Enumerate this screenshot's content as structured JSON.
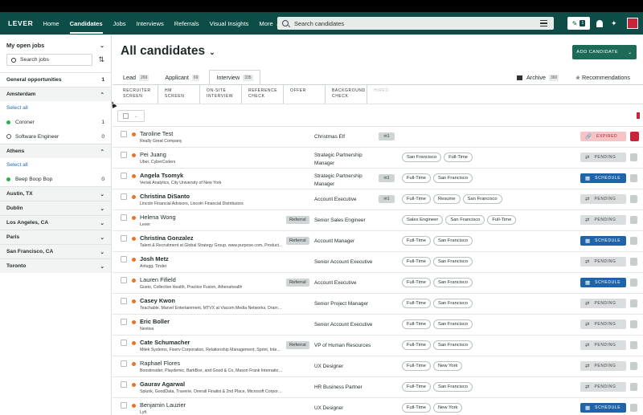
{
  "nav": {
    "logo": "LEVER",
    "items": [
      "Home",
      "Candidates",
      "Jobs",
      "Interviews",
      "Referrals",
      "Visual Insights",
      "More"
    ],
    "search_placeholder": "Search candidates",
    "note_count": "1"
  },
  "sidebar": {
    "title": "My open jobs",
    "search_placeholder": "Search jobs",
    "general": {
      "label": "General opportunities",
      "count": "1"
    },
    "amsterdam": {
      "label": "Amsterdam",
      "select_all": "Select all",
      "jobs": [
        {
          "name": "Coroner",
          "count": "1"
        },
        {
          "name": "Software Engineer",
          "count": "0"
        }
      ]
    },
    "athens": {
      "label": "Athens",
      "select_all": "Select all",
      "jobs": [
        {
          "name": "Beep Boop Bop",
          "count": "0"
        }
      ]
    },
    "collapsed": [
      "Austin, TX",
      "Dublin",
      "Los Angeles, CA",
      "Paris",
      "San Francisco, CA",
      "Toronto"
    ]
  },
  "main": {
    "title": "All candidates",
    "add_button": "ADD CANDIDATE",
    "tabs": [
      {
        "label": "Lead",
        "count": "269"
      },
      {
        "label": "Applicant",
        "count": "69"
      },
      {
        "label": "Interview",
        "count": "335"
      }
    ],
    "archive": {
      "label": "Archive",
      "count": "360"
    },
    "recommendations": "Recommendations",
    "stages": [
      "RECRUITER SCREEN",
      "HM SCREEN",
      "ON-SITE INTERVIEW",
      "REFERENCE CHECK",
      "OFFER",
      "BACKGROUND CHECK",
      "HIRED"
    ]
  },
  "rows": [
    {
      "name": "Taroline Test",
      "sub": "Really Great Company",
      "position": "Christmas Elf",
      "msg": "1",
      "tags": [],
      "status": "EXPIRED",
      "bold": false
    },
    {
      "name": "Pei Juang",
      "sub": "Uber, CyberCoders",
      "position": "Strategic Partnership Manager",
      "tags": [
        "San Francisco",
        "Full-Time"
      ],
      "status": "PENDING",
      "bold": false
    },
    {
      "name": "Angela Tsomyk",
      "sub": "Verisk Analytics, City University of New York",
      "position": "Strategic Partnership Manager",
      "msg": "1",
      "tags": [
        "Full-Time",
        "San Francisco"
      ],
      "status": "SCHEDULE",
      "bold": true
    },
    {
      "name": "Christina DiSanto",
      "sub": "Lincoln Financial Advisors, Lincoln Financial Distributors",
      "position": "Account Executive",
      "msg": "1",
      "tags": [
        "Full-Time",
        "Resume",
        "San Francisco"
      ],
      "status": "PENDING",
      "bold": true
    },
    {
      "name": "Helena Wong",
      "sub": "Lever",
      "referral": "Referral",
      "position": "Senior Sales Engineer",
      "tags": [
        "Sales Engineer",
        "San Francisco",
        "Full-Time"
      ],
      "status": "PENDING",
      "bold": false
    },
    {
      "name": "Christina Gonzalez",
      "sub": "Talent & Recruitment at Global Strategy Group, www.purpose.com, Product...",
      "referral": "Referral",
      "position": "Account Manager",
      "tags": [
        "Full-Time",
        "San Francisco"
      ],
      "status": "SCHEDULE",
      "bold": true
    },
    {
      "name": "Josh Metz",
      "sub": "Airlugg, Tinder",
      "position": "Senior Account Executive",
      "tags": [
        "Full-Time",
        "San Francisco"
      ],
      "status": "PENDING",
      "bold": true
    },
    {
      "name": "Lauren Fifield",
      "sub": "Gusto, Collective Health, Practice Fusion, Athenahealth",
      "referral": "Referral",
      "position": "Account Executive",
      "tags": [
        "Full-Time",
        "San Francisco"
      ],
      "status": "SCHEDULE",
      "bold": false
    },
    {
      "name": "Casey Kwon",
      "sub": "Teachable, Marvel Entertainment, MTVX at Viacom Media Networks, DramaFever, Viaco...",
      "position": "Senior Project Manager",
      "tags": [
        "Full-Time",
        "San Francisco"
      ],
      "status": "PENDING",
      "bold": true
    },
    {
      "name": "Eric Boller",
      "sub": "Nextiva",
      "position": "Senior Account Executive",
      "tags": [
        "Full-Time",
        "San Francisco"
      ],
      "status": "PENDING",
      "bold": true
    },
    {
      "name": "Cate Schumacher",
      "sub": "Mitek Systems, Fiserv Corporation, Relationship Management, Sprint, Inte...",
      "referral": "Referral",
      "position": "VP of Human Resources",
      "tags": [
        "Full-Time",
        "San Francisco"
      ],
      "status": "PENDING",
      "bold": true
    },
    {
      "name": "Raphael Flores",
      "sub": "Boostinsider, Playdemic, BarkBox, and Good & Co, Mason Frank International Ltd, The R...",
      "position": "UX Designer",
      "tags": [
        "Full-Time",
        "New York"
      ],
      "status": "PENDING",
      "bold": false
    },
    {
      "name": "Gaurav Agarwal",
      "sub": "Splunk, GoodData, Traverie, Overall Finalist & 2nd Place, Microsoft Corporation, Teradata",
      "position": "HR Business Partner",
      "tags": [
        "Full-Time",
        "San Francisco"
      ],
      "status": "PENDING",
      "bold": true
    },
    {
      "name": "Benjamin Lauzier",
      "sub": "Lyft",
      "position": "UX Designer",
      "tags": [
        "Full-Time",
        "New York"
      ],
      "status": "SCHEDULE",
      "bold": false
    }
  ]
}
